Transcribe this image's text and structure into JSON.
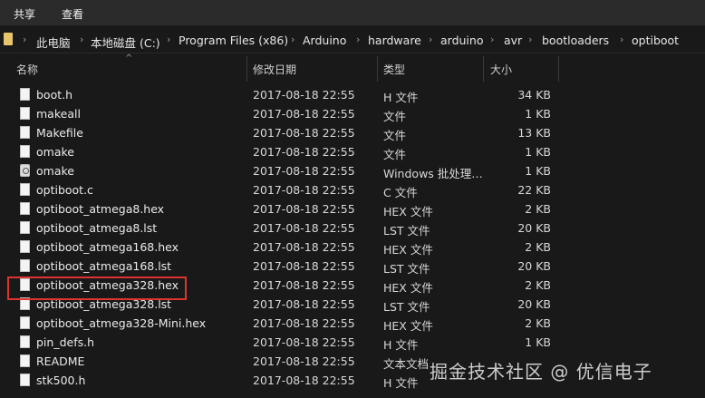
{
  "ribbon": {
    "tabs": [
      "共享",
      "查看"
    ]
  },
  "address": {
    "crumbs": [
      "此电脑",
      "本地磁盘 (C:)",
      "Program Files (x86)",
      "Arduino",
      "hardware",
      "arduino",
      "avr",
      "bootloaders",
      "optiboot"
    ]
  },
  "columns": {
    "name": "名称",
    "date": "修改日期",
    "type": "类型",
    "size": "大小"
  },
  "files": [
    {
      "name": "boot.h",
      "date": "2017-08-18 22:55",
      "type": "H 文件",
      "size": "34 KB",
      "icon": "file-icon"
    },
    {
      "name": "makeall",
      "date": "2017-08-18 22:55",
      "type": "文件",
      "size": "1 KB",
      "icon": "file-icon"
    },
    {
      "name": "Makefile",
      "date": "2017-08-18 22:55",
      "type": "文件",
      "size": "13 KB",
      "icon": "file-icon"
    },
    {
      "name": "omake",
      "date": "2017-08-18 22:55",
      "type": "文件",
      "size": "1 KB",
      "icon": "file-icon"
    },
    {
      "name": "omake",
      "date": "2017-08-18 22:55",
      "type": "Windows 批处理…",
      "size": "1 KB",
      "icon": "batch-file-icon"
    },
    {
      "name": "optiboot.c",
      "date": "2017-08-18 22:55",
      "type": "C 文件",
      "size": "22 KB",
      "icon": "file-icon"
    },
    {
      "name": "optiboot_atmega8.hex",
      "date": "2017-08-18 22:55",
      "type": "HEX 文件",
      "size": "2 KB",
      "icon": "file-icon"
    },
    {
      "name": "optiboot_atmega8.lst",
      "date": "2017-08-18 22:55",
      "type": "LST 文件",
      "size": "20 KB",
      "icon": "file-icon"
    },
    {
      "name": "optiboot_atmega168.hex",
      "date": "2017-08-18 22:55",
      "type": "HEX 文件",
      "size": "2 KB",
      "icon": "file-icon"
    },
    {
      "name": "optiboot_atmega168.lst",
      "date": "2017-08-18 22:55",
      "type": "LST 文件",
      "size": "20 KB",
      "icon": "file-icon"
    },
    {
      "name": "optiboot_atmega328.hex",
      "date": "2017-08-18 22:55",
      "type": "HEX 文件",
      "size": "2 KB",
      "icon": "file-icon"
    },
    {
      "name": "optiboot_atmega328.lst",
      "date": "2017-08-18 22:55",
      "type": "LST 文件",
      "size": "20 KB",
      "icon": "file-icon"
    },
    {
      "name": "optiboot_atmega328-Mini.hex",
      "date": "2017-08-18 22:55",
      "type": "HEX 文件",
      "size": "2 KB",
      "icon": "file-icon"
    },
    {
      "name": "pin_defs.h",
      "date": "2017-08-18 22:55",
      "type": "H 文件",
      "size": "1 KB",
      "icon": "file-icon"
    },
    {
      "name": "README",
      "date": "2017-08-18 22:55",
      "type": "文本文档",
      "size": "",
      "icon": "file-icon"
    },
    {
      "name": "stk500.h",
      "date": "2017-08-18 22:55",
      "type": "H 文件",
      "size": "",
      "icon": "file-icon"
    }
  ],
  "highlighted_file": "optiboot_atmega328.hex",
  "watermark": "掘金技术社区 @ 优信电子",
  "colors": {
    "background": "#191919",
    "highlight": "#e0322e"
  }
}
